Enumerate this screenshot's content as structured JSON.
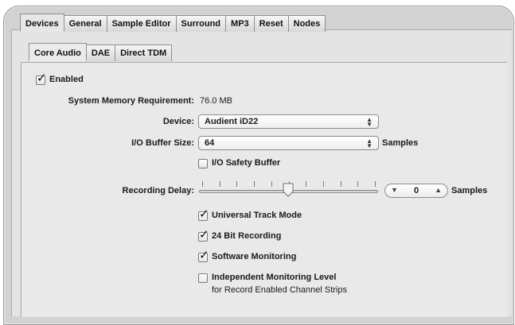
{
  "top_tabs": [
    "Devices",
    "General",
    "Sample Editor",
    "Surround",
    "MP3",
    "Reset",
    "Nodes"
  ],
  "sub_tabs": [
    "Core Audio",
    "DAE",
    "Direct TDM"
  ],
  "enabled": {
    "label": "Enabled",
    "checked": true
  },
  "memory": {
    "label": "System Memory Requirement:",
    "value": "76.0 MB"
  },
  "device": {
    "label": "Device:",
    "value": "Audient iD22"
  },
  "buffer": {
    "label": "I/O Buffer Size:",
    "value": "64",
    "unit": "Samples"
  },
  "safety_buffer": {
    "label": "I/O Safety Buffer",
    "checked": false
  },
  "recording_delay": {
    "label": "Recording Delay:",
    "value": "0",
    "unit": "Samples",
    "ticks": 11
  },
  "options": [
    {
      "label": "Universal Track Mode",
      "checked": true
    },
    {
      "label": "24 Bit Recording",
      "checked": true
    },
    {
      "label": "Software Monitoring",
      "checked": true
    },
    {
      "label": "Independent Monitoring Level",
      "checked": false,
      "sublabel": "for Record Enabled Channel Strips"
    }
  ],
  "icons": {
    "check": "checkmark-icon",
    "popup": "up-down-arrows-icon"
  }
}
